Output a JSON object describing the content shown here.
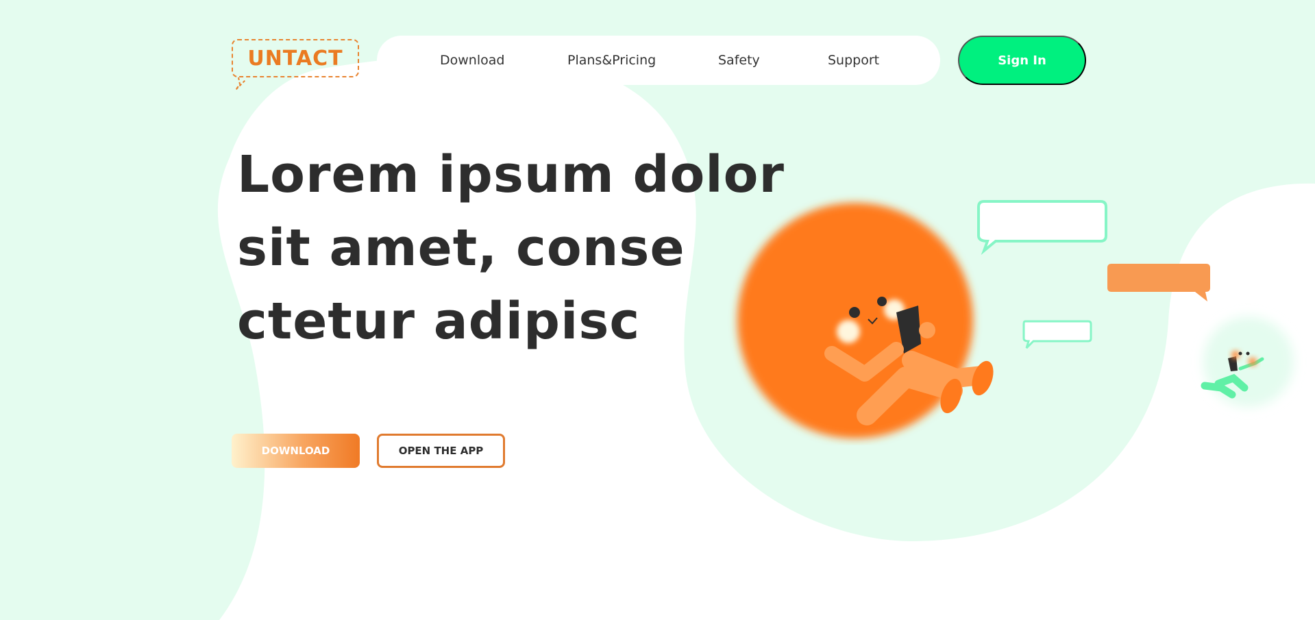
{
  "brand": {
    "logo_text": "UNTACT"
  },
  "nav": {
    "items": [
      {
        "label": "Download"
      },
      {
        "label": "Plans&Pricing"
      },
      {
        "label": "Safety"
      },
      {
        "label": "Support"
      }
    ],
    "sign_in_label": "Sign In"
  },
  "hero": {
    "headline_lines": [
      "Lorem ipsum dolor",
      "sit amet, conse",
      "ctetur adipisc"
    ],
    "download_label": "DOWNLOAD",
    "open_app_label": "OPEN THE APP"
  },
  "colors": {
    "background": "#e4fcef",
    "accent_green": "#00f07f",
    "accent_orange": "#ff7a1d",
    "text_dark": "#2d2d2d"
  }
}
